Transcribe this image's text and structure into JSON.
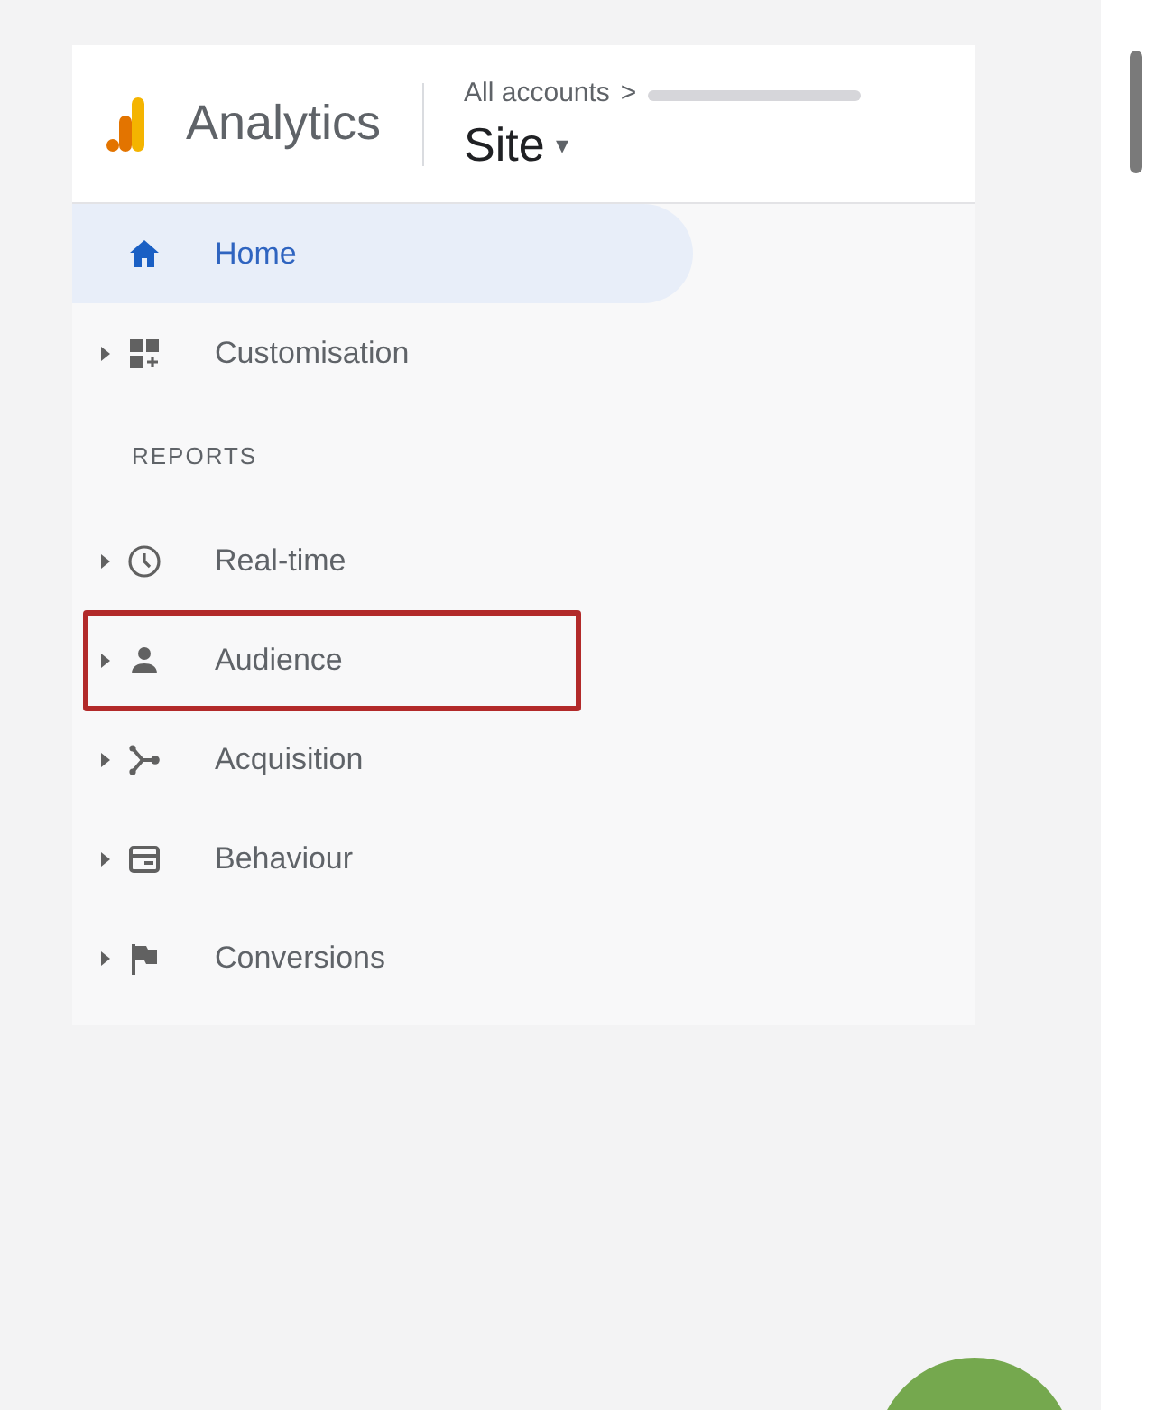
{
  "header": {
    "product": "Analytics",
    "breadcrumb": "All accounts",
    "separator": ">",
    "property": "Site",
    "dropdown_caret": "▾"
  },
  "nav": [
    {
      "label": "Home",
      "selected": true,
      "expandable": false,
      "highlighted": false
    },
    {
      "label": "Customisation",
      "selected": false,
      "expandable": true,
      "highlighted": false
    }
  ],
  "section_label": "REPORTS",
  "reports": [
    {
      "label": "Real-time",
      "selected": false,
      "expandable": true,
      "highlighted": false
    },
    {
      "label": "Audience",
      "selected": false,
      "expandable": true,
      "highlighted": true
    },
    {
      "label": "Acquisition",
      "selected": false,
      "expandable": true,
      "highlighted": false
    },
    {
      "label": "Behaviour",
      "selected": false,
      "expandable": true,
      "highlighted": false
    },
    {
      "label": "Conversions",
      "selected": false,
      "expandable": true,
      "highlighted": false
    }
  ]
}
